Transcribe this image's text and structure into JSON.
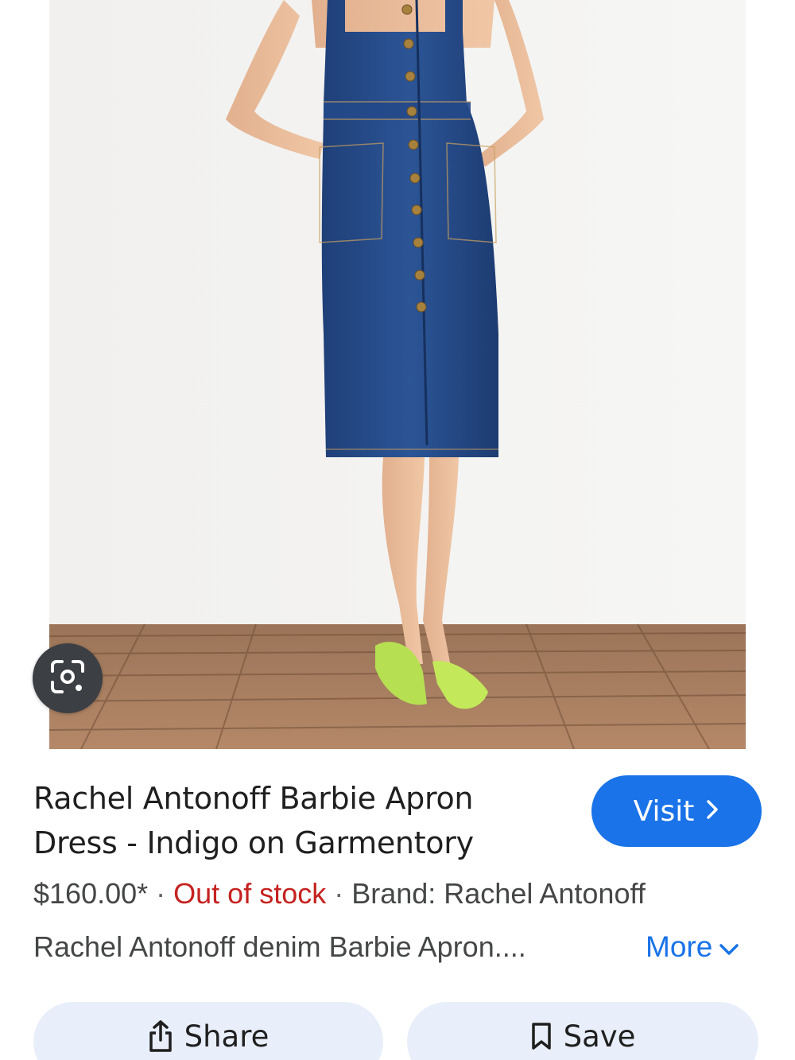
{
  "product": {
    "title_line1": "Rachel Antonoff Barbie Apron",
    "title_line2": "Dress - Indigo on Garmentory",
    "price": "$160.00*",
    "stock_status": "Out of stock",
    "brand": "Brand: Rachel Antonoff",
    "separator": "·",
    "description": "Rachel Antonoff denim Barbie Apron...."
  },
  "actions": {
    "visit_label": "Visit",
    "more_label": "More",
    "share_label": "Share",
    "save_label": "Save"
  },
  "icons": {
    "lens": "google-lens-icon",
    "visit_chevron": "chevron-right-icon",
    "more_chevron": "chevron-down-icon",
    "share": "share-icon",
    "save": "bookmark-icon"
  },
  "colors": {
    "accent": "#1a73e8",
    "stock_status": "#c5221f",
    "button_bg": "#e8eefa"
  }
}
